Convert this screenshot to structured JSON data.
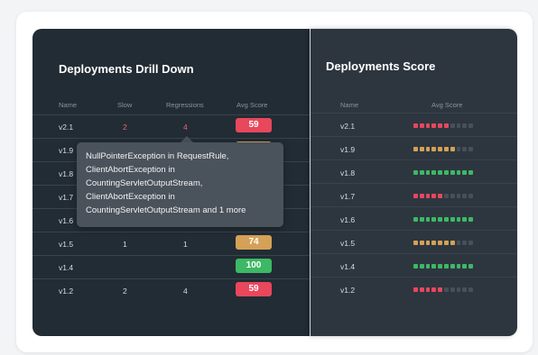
{
  "drill": {
    "title": "Deployments Drill Down",
    "headers": {
      "name": "Name",
      "slow": "Slow",
      "regressions": "Regressions",
      "avg_score": "Avg Score"
    },
    "rows": [
      {
        "name": "v2.1",
        "slow": "2",
        "regressions": "4",
        "score": "59",
        "color": "#e8475c"
      },
      {
        "name": "v1.9",
        "slow": "",
        "regressions": "",
        "score": "",
        "color": "#d4a157"
      },
      {
        "name": "v1.8",
        "slow": "",
        "regressions": "",
        "score": "",
        "color": "#3db865"
      },
      {
        "name": "v1.7",
        "slow": "",
        "regressions": "",
        "score": "",
        "color": "#e8475c"
      },
      {
        "name": "v1.6",
        "slow": "",
        "regressions": "",
        "score": "",
        "color": "#3db865"
      },
      {
        "name": "v1.5",
        "slow": "1",
        "regressions": "1",
        "score": "74",
        "color": "#d4a157"
      },
      {
        "name": "v1.4",
        "slow": "",
        "regressions": "",
        "score": "100",
        "color": "#3db865"
      },
      {
        "name": "v1.2",
        "slow": "2",
        "regressions": "4",
        "score": "59",
        "color": "#e8475c"
      }
    ]
  },
  "tooltip": {
    "line1": "NullPointerException in RequestRule,",
    "line2": "ClientAbortException in",
    "line3": "CountingServletOutputStream,",
    "line4": "ClientAbortException in",
    "line5": "CountingServletOutputStream and 1 more"
  },
  "score": {
    "title": "Deployments Score",
    "headers": {
      "name": "Name",
      "avg_score": "Avg Score"
    },
    "rows": [
      {
        "name": "v2.1",
        "filled": 6,
        "total": 10,
        "color": "red"
      },
      {
        "name": "v1.9",
        "filled": 7,
        "total": 10,
        "color": "amber"
      },
      {
        "name": "v1.8",
        "filled": 10,
        "total": 10,
        "color": "green"
      },
      {
        "name": "v1.7",
        "filled": 5,
        "total": 10,
        "color": "red"
      },
      {
        "name": "v1.6",
        "filled": 10,
        "total": 10,
        "color": "green"
      },
      {
        "name": "v1.5",
        "filled": 7,
        "total": 10,
        "color": "amber"
      },
      {
        "name": "v1.4",
        "filled": 10,
        "total": 10,
        "color": "green"
      },
      {
        "name": "v1.2",
        "filled": 5,
        "total": 10,
        "color": "red"
      }
    ]
  }
}
